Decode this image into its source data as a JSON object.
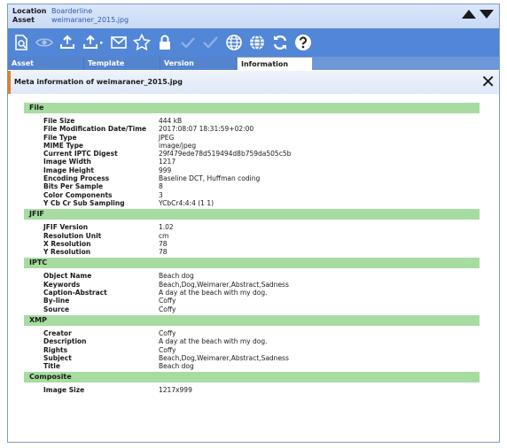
{
  "location": {
    "label": "Location",
    "value": "Boarderline"
  },
  "asset": {
    "label": "Asset",
    "value": "weimaraner_2015.jpg"
  },
  "tabs": [
    {
      "label": "Asset"
    },
    {
      "label": "Template"
    },
    {
      "label": "Version"
    },
    {
      "label": "Information"
    }
  ],
  "meta_title": "Meta information of weimaraner_2015.jpg",
  "toolbar_icons": [
    "document-search-icon",
    "eye-icon",
    "upload-icon",
    "upload-dropdown-icon",
    "mail-icon",
    "star-icon",
    "lock-icon",
    "check-icon",
    "check-double-icon",
    "globe-icon",
    "globe-double-icon",
    "refresh-icon",
    "help-icon"
  ],
  "sections": {
    "file": {
      "title": "File",
      "rows": [
        {
          "key": "File Size",
          "value": "444 kB"
        },
        {
          "key": "File Modification Date/Time",
          "value": "2017:08:07 18:31:59+02:00"
        },
        {
          "key": "File Type",
          "value": "JPEG"
        },
        {
          "key": "MIME Type",
          "value": "image/jpeg"
        },
        {
          "key": "Current IPTC Digest",
          "value": "29f479ede78d519494d8b759da505c5b"
        },
        {
          "key": "Image Width",
          "value": "1217"
        },
        {
          "key": "Image Height",
          "value": "999"
        },
        {
          "key": "Encoding Process",
          "value": "Baseline DCT, Huffman coding"
        },
        {
          "key": "Bits Per Sample",
          "value": "8"
        },
        {
          "key": "Color Components",
          "value": "3"
        },
        {
          "key": "Y Cb Cr Sub Sampling",
          "value": "YCbCr4:4:4 (1 1)"
        }
      ]
    },
    "jfif": {
      "title": "JFIF",
      "rows": [
        {
          "key": "JFIF Version",
          "value": "1.02"
        },
        {
          "key": "Resolution Unit",
          "value": "cm"
        },
        {
          "key": "X Resolution",
          "value": "78"
        },
        {
          "key": "Y Resolution",
          "value": "78"
        }
      ]
    },
    "iptc": {
      "title": "IPTC",
      "rows": [
        {
          "key": "Object Name",
          "value": "Beach dog"
        },
        {
          "key": "Keywords",
          "value": "Beach,Dog,Weimarer,Abstract,Sadness"
        },
        {
          "key": "Caption-Abstract",
          "value": "A day at the beach with my dog."
        },
        {
          "key": "By-line",
          "value": "Coffy"
        },
        {
          "key": "Source",
          "value": "Coffy"
        }
      ]
    },
    "xmp": {
      "title": "XMP",
      "rows": [
        {
          "key": "Creator",
          "value": "Coffy"
        },
        {
          "key": "Description",
          "value": "A day at the beach with my dog."
        },
        {
          "key": "Rights",
          "value": "Coffy"
        },
        {
          "key": "Subject",
          "value": "Beach,Dog,Weimarer,Abstract,Sadness"
        },
        {
          "key": "Title",
          "value": "Beach dog"
        }
      ]
    },
    "composite": {
      "title": "Composite",
      "rows": [
        {
          "key": "Image Size",
          "value": "1217x999"
        }
      ]
    }
  }
}
